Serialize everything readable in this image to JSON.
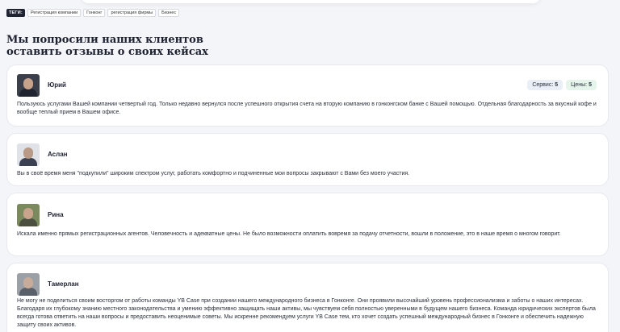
{
  "tags": {
    "label": "ТЕГИ:",
    "items": [
      "Регистрация компании",
      "Гонконг",
      "регистрация фирмы",
      "Бизнес"
    ]
  },
  "section": {
    "title": "Мы попросили наших клиентов оставить отзывы о своих кейсах"
  },
  "reviews": [
    {
      "name": "Юрий",
      "text": "Пользуюсь услугами Вашей компании четвертый год. Только недавно вернулся после успешного открытия счета на вторую компанию в гонконгском банке с Вашей помощью. Отдельная благодарность за вкусный кофе и вообще теплый прием в Вашем офисе.",
      "service_label": "Сервис:",
      "service_value": "5",
      "price_label": "Цены:",
      "price_value": "5"
    },
    {
      "name": "Аслан",
      "text": "Вы в своё время меня \"подкупили\" широким спектром услуг, работать комфортно и подчиненные мои вопросы закрывают с Вами без моего участия."
    },
    {
      "name": "Рина",
      "text": "Искала именно прямых регистрационных агентов. Человечность и адекватные цены. Не было возможности оплатить вовремя за подачу отчетности, вошли в положение, это в наше время о многом говорит."
    },
    {
      "name": "Тамерлан",
      "text": "Не могу не поделиться своим восторгом от работы команды YB Case при создании нашего международного бизнеса в Гонконге. Они проявили высочайший уровень профессионализма и заботы о наших интересах. Благодаря их глубокому знанию местного законодательства и умению эффективно защищать наши активы, мы чувствуем себя полностью уверенными в будущем нашего бизнеса. Команда юридических экспертов была всегда готова ответить на наши вопросы и предоставить неоценимые советы. Мы искренне рекомендуем услуги YB Case тем, кто хочет создать успешный международный бизнес в Гонконге и обеспечить надежную защиту своих активов."
    }
  ]
}
